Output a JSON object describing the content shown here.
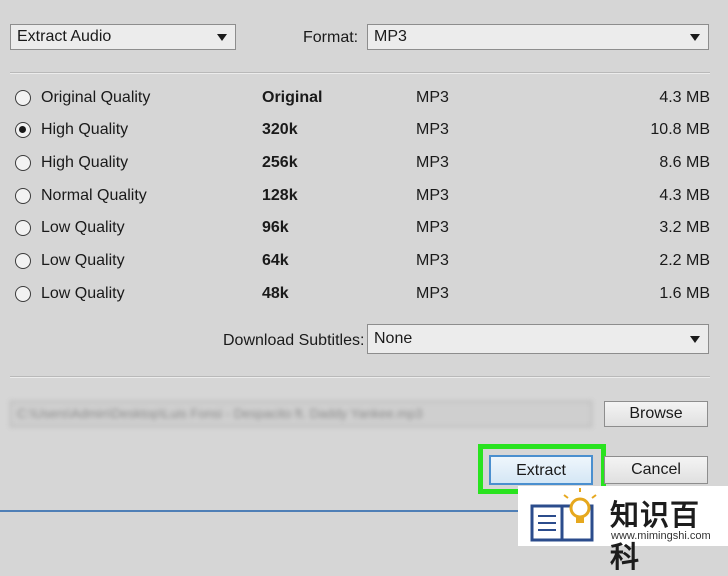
{
  "top": {
    "mode_value": "Extract Audio",
    "format_label": "Format:",
    "format_value": "MP3"
  },
  "qualities": [
    {
      "label": "Original Quality",
      "bitrate": "Original",
      "format": "MP3",
      "size": "4.3 MB",
      "selected": false
    },
    {
      "label": "High Quality",
      "bitrate": "320k",
      "format": "MP3",
      "size": "10.8 MB",
      "selected": true
    },
    {
      "label": "High Quality",
      "bitrate": "256k",
      "format": "MP3",
      "size": "8.6 MB",
      "selected": false
    },
    {
      "label": "Normal Quality",
      "bitrate": "128k",
      "format": "MP3",
      "size": "4.3 MB",
      "selected": false
    },
    {
      "label": "Low Quality",
      "bitrate": "96k",
      "format": "MP3",
      "size": "3.2 MB",
      "selected": false
    },
    {
      "label": "Low Quality",
      "bitrate": "64k",
      "format": "MP3",
      "size": "2.2 MB",
      "selected": false
    },
    {
      "label": "Low Quality",
      "bitrate": "48k",
      "format": "MP3",
      "size": "1.6 MB",
      "selected": false
    }
  ],
  "subtitles": {
    "label": "Download Subtitles:",
    "value": "None"
  },
  "output": {
    "path": "C:\\Users\\Admin\\Desktop\\Luis Fonsi - Despacito ft. Daddy Yankee.mp3",
    "browse_label": "Browse"
  },
  "actions": {
    "extract_label": "Extract",
    "cancel_label": "Cancel"
  },
  "watermark": {
    "brand": "知识百科",
    "url": "www.mimingshi.com"
  },
  "colors": {
    "highlight": "#29e31f",
    "accent": "#4a8fcf",
    "background": "#d6d6d6"
  }
}
